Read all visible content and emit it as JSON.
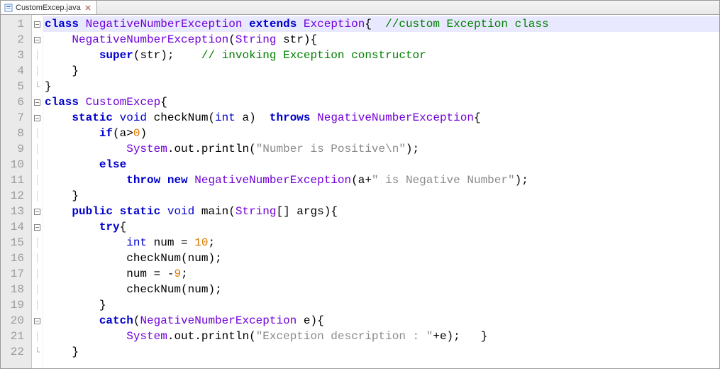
{
  "tab": {
    "filename": "CustomExcep.java"
  },
  "gutter": {
    "start": 1,
    "end": 22
  },
  "fold": [
    "box",
    "box",
    "",
    "",
    "end",
    "box",
    "box",
    "",
    "",
    "",
    "",
    "",
    "box",
    "box",
    "",
    "",
    "",
    "",
    "",
    "box",
    "",
    "end"
  ],
  "code": [
    [
      [
        "kw",
        "class"
      ],
      [
        "",
        " "
      ],
      [
        "ty",
        "NegativeNumberException"
      ],
      [
        "",
        " "
      ],
      [
        "kw",
        "extends"
      ],
      [
        "",
        " "
      ],
      [
        "ty",
        "Exception"
      ],
      [
        "op",
        "{"
      ],
      [
        "",
        "  "
      ],
      [
        "cm",
        "//custom Exception class"
      ]
    ],
    [
      [
        "",
        "    "
      ],
      [
        "ty",
        "NegativeNumberException"
      ],
      [
        "op",
        "("
      ],
      [
        "ty",
        "String"
      ],
      [
        "",
        " str"
      ],
      [
        "op",
        ")"
      ],
      [
        "op",
        "{"
      ]
    ],
    [
      [
        "",
        "        "
      ],
      [
        "kw",
        "super"
      ],
      [
        "op",
        "("
      ],
      [
        "",
        "str"
      ],
      [
        "op",
        ")"
      ],
      [
        "op",
        ";"
      ],
      [
        "",
        "    "
      ],
      [
        "cm",
        "// invoking Exception constructor"
      ]
    ],
    [
      [
        "",
        "    "
      ],
      [
        "op",
        "}"
      ]
    ],
    [
      [
        "op",
        "}"
      ]
    ],
    [
      [
        "kw",
        "class"
      ],
      [
        "",
        " "
      ],
      [
        "ty",
        "CustomExcep"
      ],
      [
        "op",
        "{"
      ]
    ],
    [
      [
        "",
        "    "
      ],
      [
        "kw",
        "static"
      ],
      [
        "",
        " "
      ],
      [
        "kw2",
        "void"
      ],
      [
        "",
        " "
      ],
      [
        "",
        "checkNum"
      ],
      [
        "op",
        "("
      ],
      [
        "kw2",
        "int"
      ],
      [
        "",
        " a"
      ],
      [
        "op",
        ")"
      ],
      [
        "",
        "  "
      ],
      [
        "kw",
        "throws"
      ],
      [
        "",
        " "
      ],
      [
        "ty",
        "NegativeNumberException"
      ],
      [
        "op",
        "{"
      ]
    ],
    [
      [
        "",
        "        "
      ],
      [
        "kw",
        "if"
      ],
      [
        "op",
        "("
      ],
      [
        "",
        "a"
      ],
      [
        "op",
        ">"
      ],
      [
        "nm",
        "0"
      ],
      [
        "op",
        ")"
      ]
    ],
    [
      [
        "",
        "            "
      ],
      [
        "ty",
        "System"
      ],
      [
        "op",
        "."
      ],
      [
        "",
        "out"
      ],
      [
        "op",
        "."
      ],
      [
        "",
        "println"
      ],
      [
        "op",
        "("
      ],
      [
        "st",
        "\"Number is Positive\\n\""
      ],
      [
        "op",
        ")"
      ],
      [
        "op",
        ";"
      ]
    ],
    [
      [
        "",
        "        "
      ],
      [
        "kw",
        "else"
      ]
    ],
    [
      [
        "",
        "            "
      ],
      [
        "kw",
        "throw"
      ],
      [
        "",
        " "
      ],
      [
        "kw",
        "new"
      ],
      [
        "",
        " "
      ],
      [
        "ty",
        "NegativeNumberException"
      ],
      [
        "op",
        "("
      ],
      [
        "",
        "a"
      ],
      [
        "op",
        "+"
      ],
      [
        "st",
        "\" is Negative Number\""
      ],
      [
        "op",
        ")"
      ],
      [
        "op",
        ";"
      ]
    ],
    [
      [
        "",
        "    "
      ],
      [
        "op",
        "}"
      ]
    ],
    [
      [
        "",
        "    "
      ],
      [
        "kw",
        "public"
      ],
      [
        "",
        " "
      ],
      [
        "kw",
        "static"
      ],
      [
        "",
        " "
      ],
      [
        "kw2",
        "void"
      ],
      [
        "",
        " "
      ],
      [
        "",
        "main"
      ],
      [
        "op",
        "("
      ],
      [
        "ty",
        "String"
      ],
      [
        "op",
        "[]"
      ],
      [
        "",
        " args"
      ],
      [
        "op",
        ")"
      ],
      [
        "op",
        "{"
      ]
    ],
    [
      [
        "",
        "        "
      ],
      [
        "kw",
        "try"
      ],
      [
        "op",
        "{"
      ]
    ],
    [
      [
        "",
        "            "
      ],
      [
        "kw2",
        "int"
      ],
      [
        "",
        " num "
      ],
      [
        "op",
        "="
      ],
      [
        "",
        " "
      ],
      [
        "nm",
        "10"
      ],
      [
        "op",
        ";"
      ]
    ],
    [
      [
        "",
        "            "
      ],
      [
        "",
        "checkNum"
      ],
      [
        "op",
        "("
      ],
      [
        "",
        "num"
      ],
      [
        "op",
        ")"
      ],
      [
        "op",
        ";"
      ]
    ],
    [
      [
        "",
        "            "
      ],
      [
        "",
        "num "
      ],
      [
        "op",
        "="
      ],
      [
        "",
        " "
      ],
      [
        "op",
        "-"
      ],
      [
        "nm",
        "9"
      ],
      [
        "op",
        ";"
      ]
    ],
    [
      [
        "",
        "            "
      ],
      [
        "",
        "checkNum"
      ],
      [
        "op",
        "("
      ],
      [
        "",
        "num"
      ],
      [
        "op",
        ")"
      ],
      [
        "op",
        ";"
      ]
    ],
    [
      [
        "",
        "        "
      ],
      [
        "op",
        "}"
      ]
    ],
    [
      [
        "",
        "        "
      ],
      [
        "kw",
        "catch"
      ],
      [
        "op",
        "("
      ],
      [
        "ty",
        "NegativeNumberException"
      ],
      [
        "",
        " e"
      ],
      [
        "op",
        ")"
      ],
      [
        "op",
        "{"
      ]
    ],
    [
      [
        "",
        "            "
      ],
      [
        "ty",
        "System"
      ],
      [
        "op",
        "."
      ],
      [
        "",
        "out"
      ],
      [
        "op",
        "."
      ],
      [
        "",
        "println"
      ],
      [
        "op",
        "("
      ],
      [
        "st",
        "\"Exception description : \""
      ],
      [
        "op",
        "+"
      ],
      [
        "",
        "e"
      ],
      [
        "op",
        ")"
      ],
      [
        "op",
        ";"
      ],
      [
        "",
        "   "
      ],
      [
        "op",
        "}"
      ]
    ],
    [
      [
        "",
        "    "
      ],
      [
        "op",
        "}"
      ]
    ]
  ]
}
